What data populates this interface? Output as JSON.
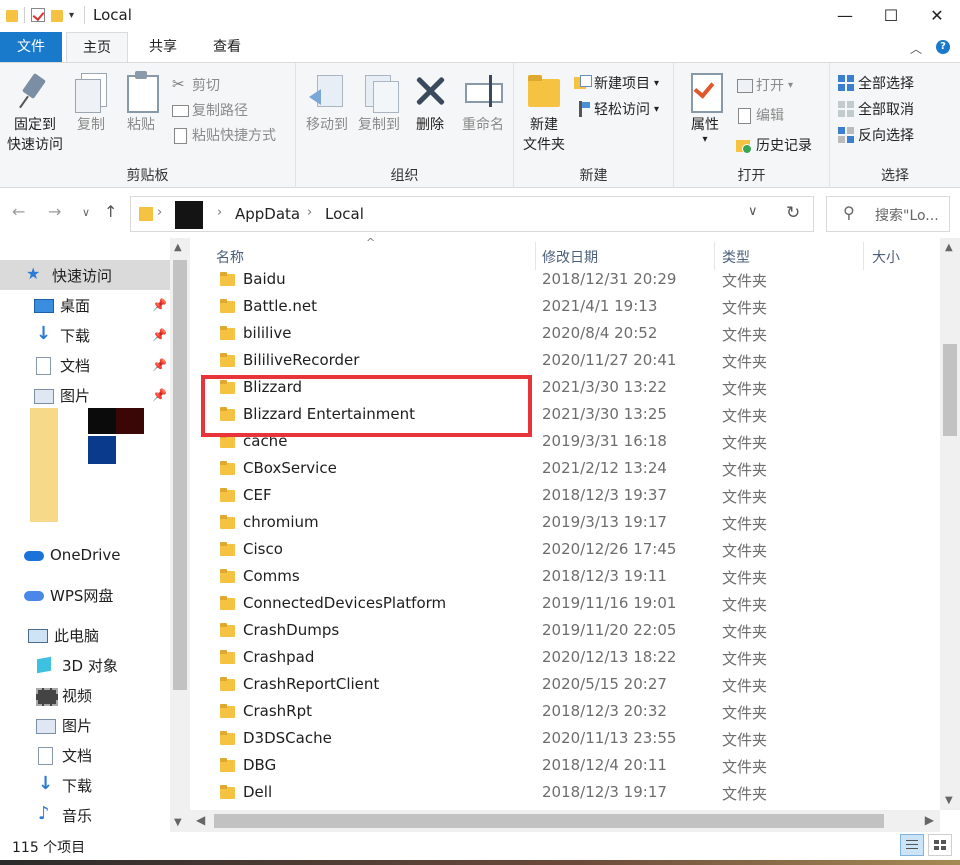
{
  "window": {
    "title": "Local",
    "minimize": "—",
    "maximize": "☐",
    "close": "✕"
  },
  "tabs": {
    "file": "文件",
    "home": "主页",
    "share": "共享",
    "view": "查看"
  },
  "ribbon": {
    "clipboard": {
      "label": "剪贴板",
      "pin_line1": "固定到",
      "pin_line2": "快速访问",
      "copy": "复制",
      "paste": "粘贴",
      "cut": "剪切",
      "copy_path": "复制路径",
      "paste_shortcut": "粘贴快捷方式"
    },
    "organize": {
      "label": "组织",
      "move_to": "移动到",
      "copy_to": "复制到",
      "delete": "删除",
      "rename": "重命名"
    },
    "new": {
      "label": "新建",
      "new_folder_line1": "新建",
      "new_folder_line2": "文件夹",
      "new_item": "新建项目",
      "easy_access": "轻松访问"
    },
    "open": {
      "label": "打开",
      "properties": "属性",
      "open": "打开",
      "edit": "编辑",
      "history": "历史记录"
    },
    "select": {
      "label": "选择",
      "select_all": "全部选择",
      "select_none": "全部取消",
      "invert": "反向选择"
    }
  },
  "address": {
    "crumbs": [
      "AppData",
      "Local"
    ],
    "search_placeholder": "搜索\"Lo..."
  },
  "nav": {
    "quick_access": "快速访问",
    "desktop": "桌面",
    "downloads": "下载",
    "documents": "文档",
    "pictures": "图片",
    "onedrive": "OneDrive",
    "wps": "WPS网盘",
    "this_pc": "此电脑",
    "objects3d": "3D 对象",
    "videos": "视频",
    "pc_pictures": "图片",
    "pc_documents": "文档",
    "pc_downloads": "下载",
    "music": "音乐"
  },
  "columns": {
    "name": "名称",
    "date": "修改日期",
    "type": "类型",
    "size": "大小"
  },
  "files": [
    {
      "name": "Baidu",
      "date": "2018/12/31 20:29",
      "type": "文件夹"
    },
    {
      "name": "Battle.net",
      "date": "2021/4/1 19:13",
      "type": "文件夹"
    },
    {
      "name": "bililive",
      "date": "2020/8/4 20:52",
      "type": "文件夹"
    },
    {
      "name": "BililiveRecorder",
      "date": "2020/11/27 20:41",
      "type": "文件夹"
    },
    {
      "name": "Blizzard",
      "date": "2021/3/30 13:22",
      "type": "文件夹"
    },
    {
      "name": "Blizzard Entertainment",
      "date": "2021/3/30 13:25",
      "type": "文件夹"
    },
    {
      "name": "cache",
      "date": "2019/3/31 16:18",
      "type": "文件夹"
    },
    {
      "name": "CBoxService",
      "date": "2021/2/12 13:24",
      "type": "文件夹"
    },
    {
      "name": "CEF",
      "date": "2018/12/3 19:37",
      "type": "文件夹"
    },
    {
      "name": "chromium",
      "date": "2019/3/13 19:17",
      "type": "文件夹"
    },
    {
      "name": "Cisco",
      "date": "2020/12/26 17:45",
      "type": "文件夹"
    },
    {
      "name": "Comms",
      "date": "2018/12/3 19:11",
      "type": "文件夹"
    },
    {
      "name": "ConnectedDevicesPlatform",
      "date": "2019/11/16 19:01",
      "type": "文件夹"
    },
    {
      "name": "CrashDumps",
      "date": "2019/11/20 22:05",
      "type": "文件夹"
    },
    {
      "name": "Crashpad",
      "date": "2020/12/13 18:22",
      "type": "文件夹"
    },
    {
      "name": "CrashReportClient",
      "date": "2020/5/15 20:27",
      "type": "文件夹"
    },
    {
      "name": "CrashRpt",
      "date": "2018/12/3 20:32",
      "type": "文件夹"
    },
    {
      "name": "D3DSCache",
      "date": "2020/11/13 23:55",
      "type": "文件夹"
    },
    {
      "name": "DBG",
      "date": "2018/12/4 20:11",
      "type": "文件夹"
    },
    {
      "name": "Dell",
      "date": "2018/12/3 19:17",
      "type": "文件夹"
    }
  ],
  "status": {
    "count": "115 个项目"
  },
  "colors": {
    "file_tab": "#1979ca",
    "highlight": "#e8333a",
    "folder": "#f5c242"
  }
}
